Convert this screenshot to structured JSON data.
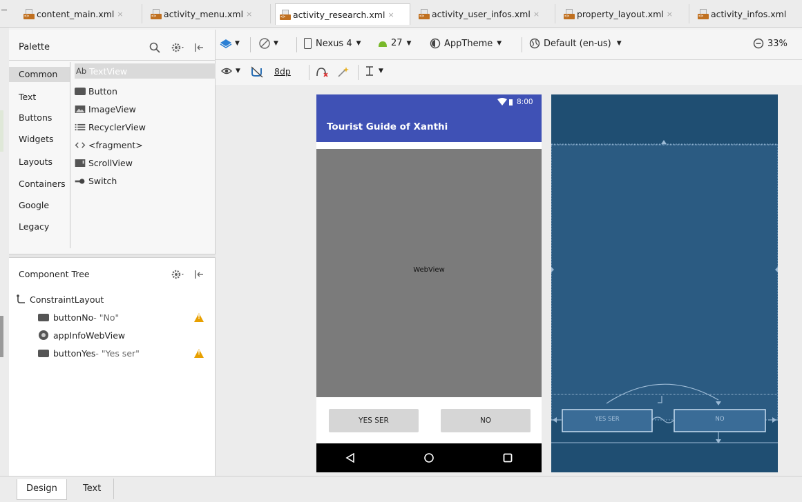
{
  "tabs": [
    {
      "label": "content_main.xml",
      "close": "×"
    },
    {
      "label": "activity_menu.xml",
      "close": "×"
    },
    {
      "label": "activity_research.xml",
      "close": "×"
    },
    {
      "label": "activity_user_infos.xml",
      "close": "×"
    },
    {
      "label": "property_layout.xml",
      "close": "×"
    },
    {
      "label": "activity_infos.xml",
      "close": ""
    }
  ],
  "palette": {
    "title": "Palette",
    "categories": [
      "Common",
      "Text",
      "Buttons",
      "Widgets",
      "Layouts",
      "Containers",
      "Google",
      "Legacy"
    ],
    "items": [
      {
        "label": "TextView",
        "prefix": "Ab"
      },
      {
        "label": "Button"
      },
      {
        "label": "ImageView"
      },
      {
        "label": "RecyclerView"
      },
      {
        "label": "<fragment>"
      },
      {
        "label": "ScrollView"
      },
      {
        "label": "Switch"
      }
    ]
  },
  "component_tree": {
    "title": "Component Tree",
    "root": "ConstraintLayout",
    "children": [
      {
        "id": "buttonNo",
        "text": "- \"No\"",
        "warning": true
      },
      {
        "id": "appInfoWebView",
        "text": "",
        "warning": false
      },
      {
        "id": "buttonYes",
        "text": "- \"Yes ser\"",
        "warning": true
      }
    ]
  },
  "toolbar": {
    "device": "Nexus 4",
    "api": "27",
    "theme": "AppTheme",
    "locale": "Default (en-us)",
    "zoom": "33%",
    "margin": "8dp"
  },
  "phone": {
    "time": "8:00",
    "app_title": "Tourist Guide of Xanthi",
    "webview_label": "WebView",
    "yes_label": "YES SER",
    "no_label": "NO"
  },
  "blueprint": {
    "yes_label": "YES SER",
    "no_label": "NO"
  },
  "bottom_tabs": [
    "Design",
    "Text"
  ],
  "colors": {
    "primary": "#3f51b5",
    "blueprint_bg": "#1f4e72",
    "blueprint_layout": "#2b5b82",
    "warning": "#e8a000"
  }
}
